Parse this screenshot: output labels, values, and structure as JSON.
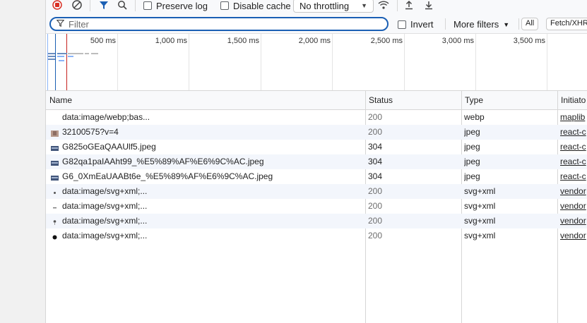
{
  "toolbar": {
    "preserve_log": "Preserve log",
    "disable_cache": "Disable cache",
    "throttling": "No throttling"
  },
  "filter_bar": {
    "placeholder": "Filter",
    "invert": "Invert",
    "more_filters": "More filters",
    "chips": [
      "All",
      "Fetch/XHR"
    ]
  },
  "overview": {
    "ticks": [
      "500 ms",
      "1,000 ms",
      "1,500 ms",
      "2,000 ms",
      "2,500 ms",
      "3,000 ms",
      "3,500 ms"
    ]
  },
  "table": {
    "headers": {
      "name": "Name",
      "status": "Status",
      "type": "Type",
      "initiator": "Initiato"
    },
    "rows": [
      {
        "name": "data:image/webp;bas...",
        "status": "200",
        "type": "webp",
        "initiator": "maplib",
        "icon": "blank-icon",
        "status_color": "#6d6d6d"
      },
      {
        "name": "32100575?v=4",
        "status": "200",
        "type": "jpeg",
        "initiator": "react-c",
        "icon": "avatar-thumb-icon",
        "status_color": "#6d6d6d"
      },
      {
        "name": "G825oGEaQAAUlf5.jpeg",
        "status": "304",
        "type": "jpeg",
        "initiator": "react-c",
        "icon": "image-thumb-icon",
        "status_color": "#1f1f1f"
      },
      {
        "name": "G82qa1paIAAht99_%E5%89%AF%E6%9C%AC.jpeg",
        "status": "304",
        "type": "jpeg",
        "initiator": "react-c",
        "icon": "image-thumb-icon",
        "status_color": "#1f1f1f"
      },
      {
        "name": "G6_0XmEaUAABt6e_%E5%89%AF%E6%9C%AC.jpeg",
        "status": "304",
        "type": "jpeg",
        "initiator": "react-c",
        "icon": "image-thumb-icon",
        "status_color": "#1f1f1f"
      },
      {
        "name": "data:image/svg+xml;...",
        "status": "200",
        "type": "svg+xml",
        "initiator": "vendor",
        "icon": "svg-dot-icon",
        "status_color": "#6d6d6d"
      },
      {
        "name": "data:image/svg+xml;...",
        "status": "200",
        "type": "svg+xml",
        "initiator": "vendor",
        "icon": "svg-dash-icon",
        "status_color": "#6d6d6d"
      },
      {
        "name": "data:image/svg+xml;...",
        "status": "200",
        "type": "svg+xml",
        "initiator": "vendor",
        "icon": "svg-pin-icon",
        "status_color": "#6d6d6d"
      },
      {
        "name": "data:image/svg+xml;...",
        "status": "200",
        "type": "svg+xml",
        "initiator": "vendor",
        "icon": "svg-circle-icon",
        "status_color": "#6d6d6d"
      }
    ]
  }
}
